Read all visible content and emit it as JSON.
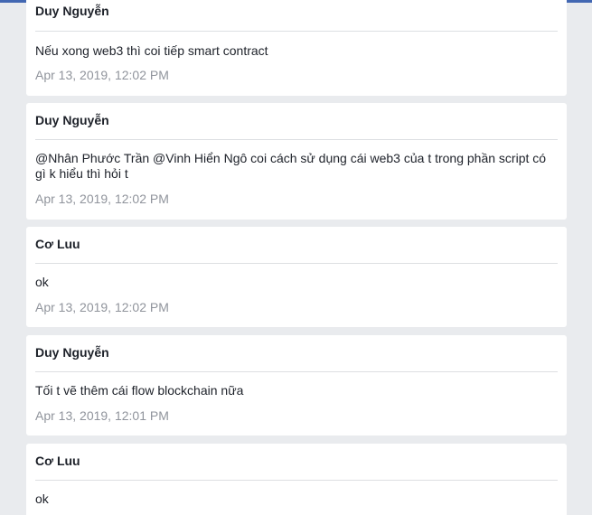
{
  "messages": [
    {
      "author": "Duy Nguyễn",
      "text": "Nếu xong web3 thì coi tiếp smart contract",
      "time": "Apr 13, 2019, 12:02 PM"
    },
    {
      "author": "Duy Nguyễn",
      "text": "@Nhân Phước Trần @Vinh Hiển Ngô coi cách sử dụng cái web3 của t trong phần script có gì k hiểu thì hỏi t",
      "time": "Apr 13, 2019, 12:02 PM"
    },
    {
      "author": "Cơ Luu",
      "text": "ok",
      "time": "Apr 13, 2019, 12:02 PM"
    },
    {
      "author": "Duy Nguyễn",
      "text": "Tối t vẽ thêm cái flow blockchain nữa",
      "time": "Apr 13, 2019, 12:01 PM"
    },
    {
      "author": "Cơ Luu",
      "text": "ok"
    }
  ]
}
